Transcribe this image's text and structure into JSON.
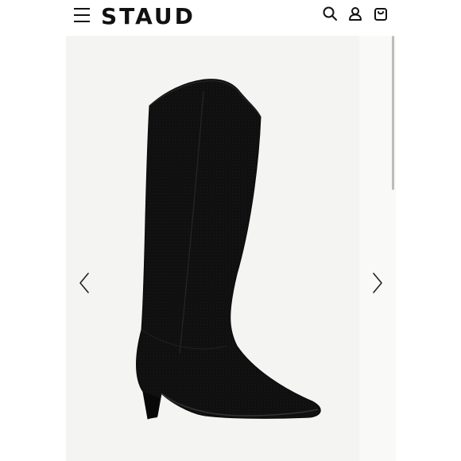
{
  "header": {
    "brand": "STAUD",
    "icons": {
      "menu": "hamburger-menu-icon",
      "search": "search-icon",
      "account": "account-icon",
      "bag": "shopping-bag-icon"
    }
  },
  "gallery": {
    "image": "black-suede-knee-high-boot",
    "prev_icon": "chevron-left-icon",
    "next_icon": "chevron-right-icon"
  },
  "colors": {
    "header_bg": "#ffffff",
    "stage_bg": "#f4f4f2",
    "boot": "#0e0e0e",
    "text": "#111111"
  }
}
